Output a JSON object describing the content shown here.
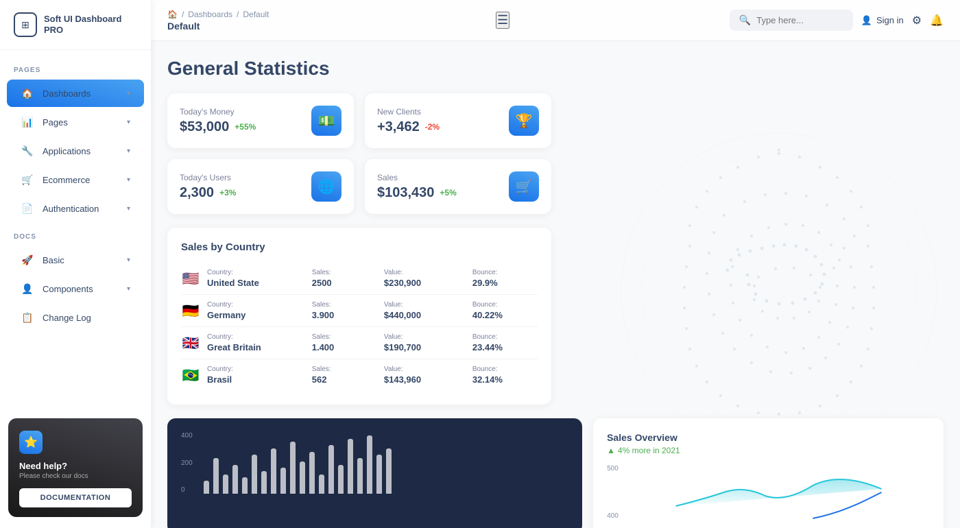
{
  "app": {
    "name": "Soft UI Dashboard PRO"
  },
  "sidebar": {
    "logo_icon": "⊞",
    "pages_label": "PAGES",
    "docs_label": "DOCS",
    "items": [
      {
        "id": "dashboards",
        "label": "Dashboards",
        "icon": "🏠",
        "active": true,
        "chevron": "▾"
      },
      {
        "id": "pages",
        "label": "Pages",
        "icon": "📊",
        "active": false,
        "chevron": "▾"
      },
      {
        "id": "applications",
        "label": "Applications",
        "icon": "🔧",
        "active": false,
        "chevron": "▾"
      },
      {
        "id": "ecommerce",
        "label": "Ecommerce",
        "icon": "🛒",
        "active": false,
        "chevron": "▾"
      },
      {
        "id": "authentication",
        "label": "Authentication",
        "icon": "📄",
        "active": false,
        "chevron": "▾"
      },
      {
        "id": "basic",
        "label": "Basic",
        "icon": "🚀",
        "active": false,
        "chevron": "▾"
      },
      {
        "id": "components",
        "label": "Components",
        "icon": "👤",
        "active": false,
        "chevron": "▾"
      },
      {
        "id": "changelog",
        "label": "Change Log",
        "icon": "📋",
        "active": false
      }
    ],
    "help": {
      "title": "Need help?",
      "subtitle": "Please check our docs",
      "button_label": "DOCUMENTATION"
    }
  },
  "topbar": {
    "breadcrumb": {
      "home_icon": "🏠",
      "sep1": "/",
      "parent": "Dashboards",
      "sep2": "/",
      "current": "Default"
    },
    "page_title": "Default",
    "search_placeholder": "Type here...",
    "sign_in_label": "Sign in",
    "hamburger": "☰"
  },
  "main": {
    "title": "General Statistics",
    "stats": [
      {
        "label": "Today's Money",
        "value": "$53,000",
        "badge": "+55%",
        "badge_type": "pos",
        "icon": "💵"
      },
      {
        "label": "New Clients",
        "value": "+3,462",
        "badge": "-2%",
        "badge_type": "neg",
        "icon": "🏆"
      },
      {
        "label": "Today's Users",
        "value": "2,300",
        "badge": "+3%",
        "badge_type": "pos",
        "icon": "🌐"
      },
      {
        "label": "Sales",
        "value": "$103,430",
        "badge": "+5%",
        "badge_type": "pos",
        "icon": "🛒"
      }
    ],
    "sales_by_country": {
      "title": "Sales by Country",
      "columns": [
        "Country:",
        "Sales:",
        "Value:",
        "Bounce:"
      ],
      "rows": [
        {
          "flag": "🇺🇸",
          "country": "United State",
          "sales": "2500",
          "value": "$230,900",
          "bounce": "29.9%"
        },
        {
          "flag": "🇩🇪",
          "country": "Germany",
          "sales": "3.900",
          "value": "$440,000",
          "bounce": "40.22%"
        },
        {
          "flag": "🇬🇧",
          "country": "Great Britain",
          "sales": "1.400",
          "value": "$190,700",
          "bounce": "23.44%"
        },
        {
          "flag": "🇧🇷",
          "country": "Brasil",
          "sales": "562",
          "value": "$143,960",
          "bounce": "32.14%"
        }
      ]
    },
    "bar_chart": {
      "y_labels": [
        "400",
        "200",
        "0"
      ],
      "bars": [
        20,
        55,
        30,
        45,
        25,
        60,
        35,
        70,
        40,
        80,
        50,
        65,
        30,
        75,
        45,
        85,
        55,
        90,
        60,
        70
      ]
    },
    "sales_overview": {
      "title": "Sales Overview",
      "subtitle": "4% more in 2021",
      "y_labels": [
        "500",
        "400"
      ]
    }
  }
}
